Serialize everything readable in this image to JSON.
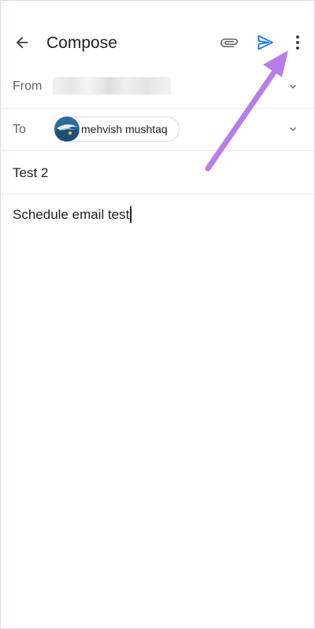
{
  "header": {
    "title": "Compose",
    "icons": {
      "back": "arrow-left-icon",
      "attach": "paperclip-icon",
      "send": "send-icon",
      "more": "more-vertical-icon"
    }
  },
  "from": {
    "label": "From"
  },
  "to": {
    "label": "To",
    "recipient": "mehvish mushtaq"
  },
  "subject": {
    "value": "Test 2"
  },
  "body": {
    "value": "Schedule email test"
  },
  "colors": {
    "send": "#1a73e8",
    "annotation_arrow": "#b77de8",
    "text": "#202124",
    "label": "#5f6368"
  }
}
